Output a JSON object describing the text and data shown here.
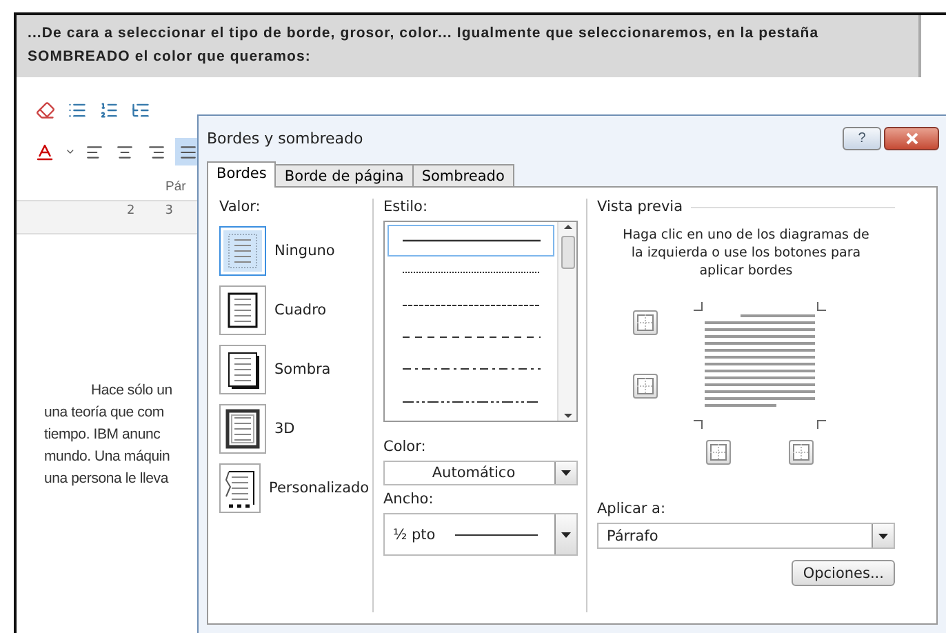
{
  "caption": {
    "lines": [
      "...De cara a seleccionar el tipo de borde, grosor, color... Igualmente que seleccionaremos, en la pestaña",
      "SOMBREADO el color que queramos:"
    ]
  },
  "ribbon": {
    "align": [
      {
        "kind": "left",
        "selected": false
      },
      {
        "kind": "center",
        "selected": false
      },
      {
        "kind": "right",
        "selected": false
      },
      {
        "kind": "justify",
        "selected": true
      }
    ],
    "group_label": "Pár",
    "ruler_numbers": [
      "2",
      "3"
    ]
  },
  "document": {
    "lines": [
      "Hace sólo un",
      "una teoría que com",
      "tiempo. IBM anunc",
      "mundo. Una máquin",
      "una persona le lleva"
    ]
  },
  "dialog": {
    "title": "Bordes y sombreado",
    "help": "?",
    "tabs": [
      {
        "label": "Bordes",
        "selected": true
      },
      {
        "label": "Borde de página",
        "selected": false
      },
      {
        "label": "Sombreado",
        "selected": false
      }
    ],
    "valor": {
      "label": "Valor:",
      "options": [
        {
          "label": "Ninguno",
          "kind": "none",
          "selected": true
        },
        {
          "label": "Cuadro",
          "kind": "box",
          "selected": false
        },
        {
          "label": "Sombra",
          "kind": "shadow",
          "selected": false
        },
        {
          "label": "3D",
          "kind": "threed",
          "selected": false
        },
        {
          "label": "Personalizado",
          "kind": "custom",
          "selected": false
        }
      ]
    },
    "estilo": {
      "label": "Estilo:",
      "styles": [
        {
          "kind": "solid",
          "selected": true
        },
        {
          "kind": "dotted",
          "selected": false
        },
        {
          "kind": "fine-dash",
          "selected": false
        },
        {
          "kind": "dash",
          "selected": false
        },
        {
          "kind": "dash-dot",
          "selected": false
        },
        {
          "kind": "dash-dot-dot",
          "selected": false
        }
      ]
    },
    "color": {
      "label": "Color:",
      "value": "Automático"
    },
    "ancho": {
      "label": "Ancho:",
      "value": "½ pto"
    },
    "preview": {
      "label": "Vista previa",
      "hint": "Haga clic en uno de los diagramas de la izquierda o use los botones para aplicar bordes"
    },
    "aplicar": {
      "label": "Aplicar a:",
      "value": "Párrafo"
    },
    "options_button": "Opciones..."
  }
}
